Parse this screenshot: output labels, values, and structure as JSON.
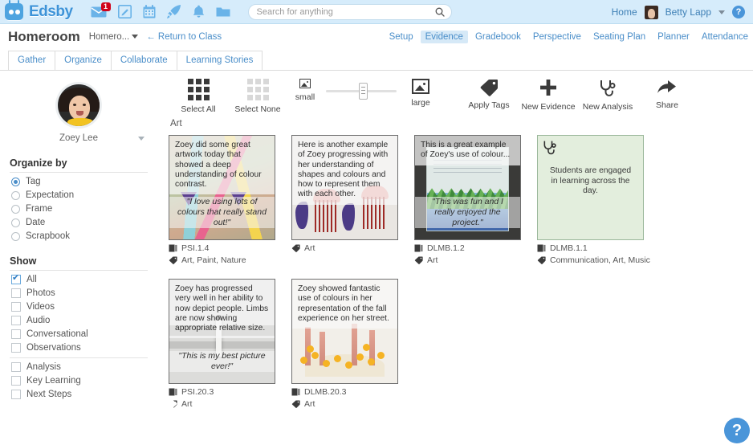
{
  "topnav": {
    "brand": "Edsby",
    "icons": [
      {
        "name": "mail-icon",
        "badge": "1"
      },
      {
        "name": "compose-icon",
        "badge": ""
      },
      {
        "name": "calendar-icon",
        "badge": ""
      },
      {
        "name": "rocket-icon",
        "badge": ""
      },
      {
        "name": "bell-icon",
        "badge": ""
      },
      {
        "name": "folder-icon",
        "badge": ""
      }
    ],
    "search": {
      "placeholder": "Search for anything",
      "value": ""
    },
    "home_label": "Home",
    "user_name": "Betty Lapp",
    "help_label": "?"
  },
  "header": {
    "title": "Homeroom",
    "class_dropdown": "Homero...",
    "return_link": "← Return to Class",
    "section_nav": [
      {
        "label": "Setup",
        "active": false
      },
      {
        "label": "Evidence",
        "active": true
      },
      {
        "label": "Gradebook",
        "active": false
      },
      {
        "label": "Perspective",
        "active": false
      },
      {
        "label": "Seating Plan",
        "active": false
      },
      {
        "label": "Planner",
        "active": false
      },
      {
        "label": "Attendance",
        "active": false
      }
    ]
  },
  "tabs": [
    {
      "label": "Gather"
    },
    {
      "label": "Organize"
    },
    {
      "label": "Collaborate"
    },
    {
      "label": "Learning Stories"
    }
  ],
  "sidebar": {
    "student_name": "Zoey Lee",
    "organize_by_title": "Organize by",
    "organize_by": [
      {
        "label": "Tag",
        "selected": true
      },
      {
        "label": "Expectation",
        "selected": false
      },
      {
        "label": "Frame",
        "selected": false
      },
      {
        "label": "Date",
        "selected": false
      },
      {
        "label": "Scrapbook",
        "selected": false
      }
    ],
    "show_title": "Show",
    "show": [
      {
        "label": "All",
        "checked": true
      },
      {
        "label": "Photos",
        "checked": false
      },
      {
        "label": "Videos",
        "checked": false
      },
      {
        "label": "Audio",
        "checked": false
      },
      {
        "label": "Conversational",
        "checked": false
      },
      {
        "label": "Observations",
        "checked": false
      },
      {
        "label": "Analysis",
        "checked": false
      },
      {
        "label": "Key Learning",
        "checked": false
      },
      {
        "label": "Next Steps",
        "checked": false
      }
    ]
  },
  "toolbar": {
    "select_all": "Select All",
    "select_none": "Select None",
    "size_small": "small",
    "size_large": "large",
    "apply_tags": "Apply Tags",
    "new_evidence": "New Evidence",
    "new_analysis": "New Analysis",
    "share": "Share"
  },
  "main": {
    "group_label": "Art",
    "cards": [
      {
        "kind": "photo",
        "art": "art1",
        "note": "Zoey did some great artwork today that showed a deep understanding of colour contrast.",
        "quote": "\"I love using lots of colours that really stand out!\"",
        "expectation": "PSI.1.4",
        "tags": "Art, Paint, Nature"
      },
      {
        "kind": "photo",
        "art": "art2",
        "note": "Here is another example of Zoey progressing with her understanding of shapes and colours and how to represent them with each other.",
        "quote": "",
        "expectation": "",
        "tags": "Art"
      },
      {
        "kind": "photo",
        "art": "art3",
        "note": "This is a great example of Zoey's use of colour...",
        "quote": "\"This was fun and I really enjoyed the project.\"",
        "expectation": "DLMB.1.2",
        "tags": "Art"
      },
      {
        "kind": "note",
        "art": "",
        "note": "Students are engaged in learning across the day.",
        "quote": "",
        "expectation": "DLMB.1.1",
        "tags": "Communication, Art, Music"
      },
      {
        "kind": "photo",
        "art": "art4",
        "note": "Zoey has progressed very well in her ability to now depict people. Limbs are now showing appropriate relative size.",
        "quote": "\"This is my best picture ever!\"",
        "expectation": "PSI.20.3",
        "tags": "Art"
      },
      {
        "kind": "photo",
        "art": "art5",
        "note": "Zoey showed fantastic use of colours in her representation of the fall experience on her street.",
        "quote": "",
        "expectation": "DLMB.20.3",
        "tags": "Art"
      }
    ]
  },
  "fab": {
    "label": "?"
  },
  "colors": {
    "brand_blue": "#3d93d8",
    "topbar_bg": "#d6ecfb",
    "link_blue": "#4a8ec9",
    "active_tab_bg": "#d6e9f7",
    "badge_red": "#d0021b",
    "note_card_bg": "#e3eedd"
  }
}
